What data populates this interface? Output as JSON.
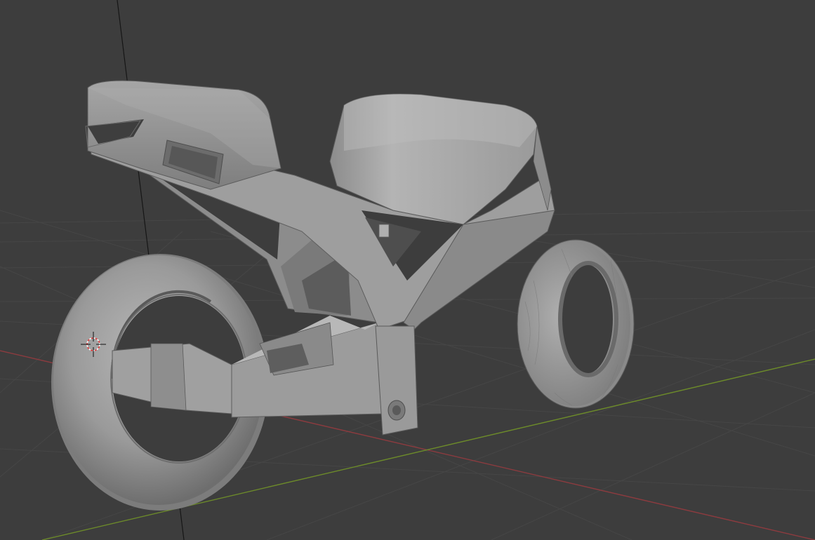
{
  "app": {
    "editor": "3D Viewport",
    "scene_object": "motorcycle-model",
    "shading": "solid"
  },
  "colors": {
    "background": "#3d3d3d",
    "grid_line": "#4a4a4a",
    "axis_x": "#8c3b3f",
    "axis_y": "#6c8a2a",
    "axis_z_line": "#151515",
    "mesh_light": "#a8a8a8",
    "mesh_mid": "#8e8e8e",
    "mesh_dark": "#6a6a6a",
    "mesh_shadow": "#4e4e4e",
    "cursor_red": "#e23b3b",
    "cursor_white": "#ffffff"
  },
  "icons": {
    "cursor": "3d-cursor-icon"
  }
}
